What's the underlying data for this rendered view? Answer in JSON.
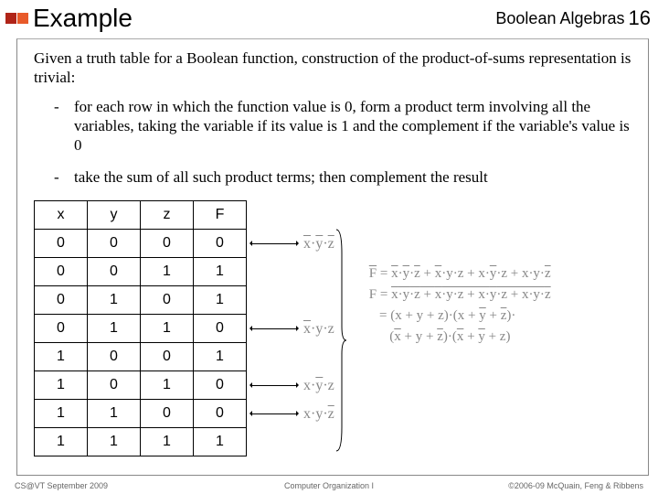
{
  "header": {
    "title": "Example",
    "topic": "Boolean Algebras",
    "pagenum": "16"
  },
  "intro": "Given a truth table for a Boolean function, construction of the product-of-sums representation is trivial:",
  "bullets": {
    "b1": "for each row in which the function value is 0, form a product term involving all the variables, taking the variable if its value is 1 and the complement if the variable's value is 0",
    "b2": "take the sum of all such product terms; then complement the result"
  },
  "truth": {
    "headers": {
      "x": "x",
      "y": "y",
      "z": "z",
      "f": "F"
    },
    "rows": [
      {
        "x": "0",
        "y": "0",
        "z": "0",
        "f": "0"
      },
      {
        "x": "0",
        "y": "0",
        "z": "1",
        "f": "1"
      },
      {
        "x": "0",
        "y": "1",
        "z": "0",
        "f": "1"
      },
      {
        "x": "0",
        "y": "1",
        "z": "1",
        "f": "0"
      },
      {
        "x": "1",
        "y": "0",
        "z": "0",
        "f": "1"
      },
      {
        "x": "1",
        "y": "0",
        "z": "1",
        "f": "0"
      },
      {
        "x": "1",
        "y": "1",
        "z": "0",
        "f": "0"
      },
      {
        "x": "1",
        "y": "1",
        "z": "1",
        "f": "1"
      }
    ]
  },
  "footer": {
    "left": "CS@VT September 2009",
    "center": "Computer Organization I",
    "right": "©2006-09  McQuain, Feng & Ribbens"
  }
}
